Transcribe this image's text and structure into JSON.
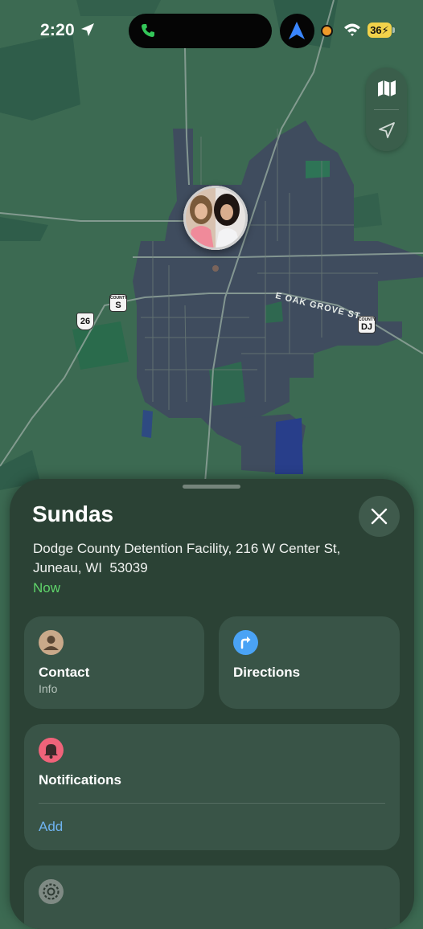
{
  "status_bar": {
    "time": "2:20",
    "battery": "36",
    "colors": {
      "battery": "#f2d24a",
      "recording_dot": "#f09a2a",
      "call": "#34c759",
      "navigation": "#3a86ff"
    }
  },
  "map": {
    "road_labels": {
      "oak_grove": "E OAK GROVE ST"
    },
    "shields": [
      {
        "top": "",
        "num": "26"
      },
      {
        "top": "COUNTY",
        "num": "S"
      },
      {
        "top": "COUNTY",
        "num": "DJ"
      }
    ],
    "controls": [
      "map-icon",
      "location-arrow-icon"
    ]
  },
  "person": {
    "name": "Sundas",
    "address_line1": "Dodge County Detention Facility, 216 W Center St,",
    "address_line2": "Juneau, WI  53039",
    "updated": "Now"
  },
  "actions": {
    "contact_label": "Contact",
    "contact_sub": "Info",
    "directions_label": "Directions"
  },
  "notifications": {
    "title": "Notifications",
    "add_label": "Add"
  },
  "colors": {
    "sheet_bg": "#2b4235",
    "card_bg": "#395447",
    "accent_link": "#6fb3f0",
    "updated_green": "#5fd46a",
    "notification_icon": "#f0637a",
    "directions_icon": "#4aa3f5",
    "contact_icon": "#c9a98a"
  }
}
